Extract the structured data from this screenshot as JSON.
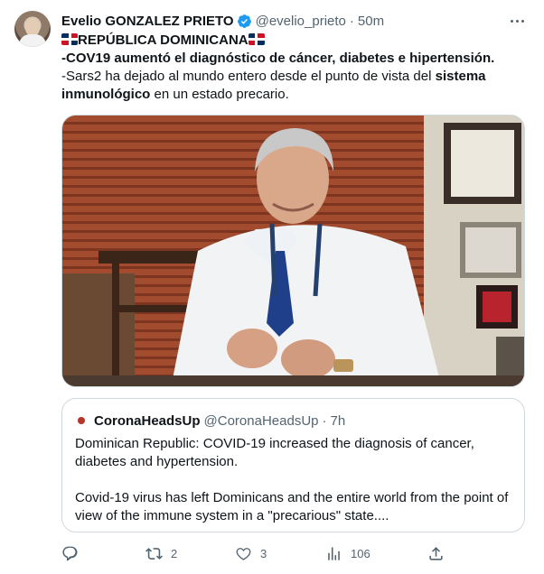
{
  "tweet": {
    "author": {
      "display_name": "Evelio GONZALEZ PRIETO",
      "handle": "@evelio_prieto",
      "separator": "·",
      "time": "50m",
      "verified_icon": "verified-badge-icon",
      "verified_color": "#1d9bf0"
    },
    "more_icon": "more-options-icon",
    "text": {
      "line1": "REPÚBLICA DOMINICANA",
      "line2": "-COV19 aumentó el diagnóstico de cáncer, diabetes e hipertensión.",
      "line3_part1": "-Sars2 ha dejado al mundo entero desde el punto de vista del ",
      "line3_bold": "sistema",
      "line4_bold": "inmunológico",
      "line4_part2": " en un estado precario."
    },
    "quoted": {
      "name": "CoronaHeadsUp",
      "handle": "@CoronaHeadsUp",
      "separator": "·",
      "time": "7h",
      "paragraph1": "Dominican Republic: COVID-19 increased the diagnosis of cancer, diabetes and hypertension.",
      "paragraph2": "Covid-19 virus has left Dominicans and the entire world from the point of view of the immune system in a \"precarious\" state...."
    },
    "actions": {
      "reply_count": "",
      "retweet_count": "2",
      "like_count": "3",
      "views_count": "106"
    },
    "colors": {
      "text": "#0f1419",
      "muted": "#536471",
      "border": "#cfd9de",
      "accent": "#1d9bf0",
      "flag_blue": "#002d62",
      "flag_red": "#ce1126"
    }
  }
}
